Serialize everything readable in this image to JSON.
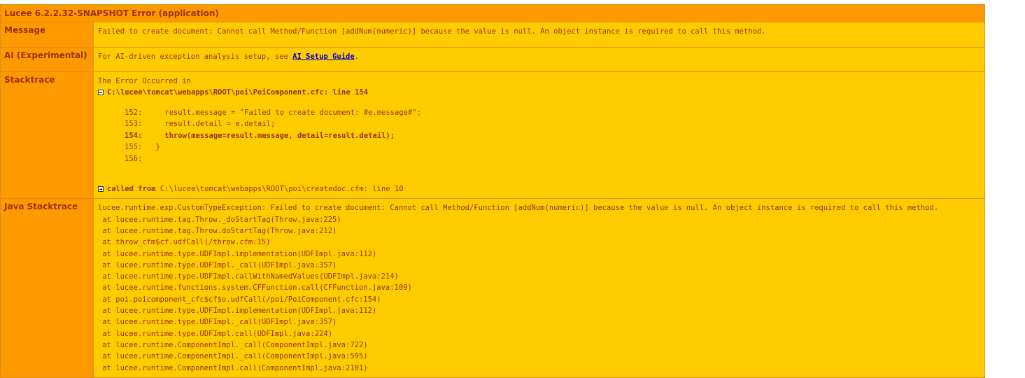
{
  "title": "Lucee 6.2.2.32-SNAPSHOT Error (application)",
  "message": {
    "label": "Message",
    "text": "Failed to create document: Cannot call Method/Function [addNum(numeric)] because the value is null. An object instance is required to call this method."
  },
  "ai": {
    "label": "AI (Experimental)",
    "prefix": "For AI-driven exception analysis setup, see ",
    "link": "AI Setup Guide",
    "suffix": "."
  },
  "stacktrace": {
    "label": "Stacktrace",
    "intro": "The Error Occurred in",
    "file": "C:\\lucee\\tomcat\\webapps\\ROOT\\poi\\PoiComponent.cfc: line 154",
    "code": [
      {
        "ln": "152:",
        "text": "    result.message = \"Failed to create document: #e.message#\";",
        "highlight": false
      },
      {
        "ln": "153:",
        "text": "    result.detail = e.detail;",
        "highlight": false
      },
      {
        "ln": "154:",
        "text": "    throw(message=result.message, detail=result.detail);",
        "highlight": true
      },
      {
        "ln": "155:",
        "text": "  }",
        "highlight": false
      },
      {
        "ln": "156:",
        "text": "",
        "highlight": false
      }
    ],
    "called_from_label": "called from",
    "called_from": " C:\\lucee\\tomcat\\webapps\\ROOT\\poi\\createdoc.cfm: line 10"
  },
  "java_stacktrace": {
    "label": "Java Stacktrace",
    "lines": [
      "lucee.runtime.exp.CustomTypeException: Failed to create document: Cannot call Method/Function [addNum(numeric)] because the value is null. An object instance is required to call this method.",
      " at lucee.runtime.tag.Throw._doStartTag(Throw.java:225)",
      " at lucee.runtime.tag.Throw.doStartTag(Throw.java:212)",
      " at throw_cfm$cf.udfCall(/throw.cfm:15)",
      " at lucee.runtime.type.UDFImpl.implementation(UDFImpl.java:112)",
      " at lucee.runtime.type.UDFImpl._call(UDFImpl.java:357)",
      " at lucee.runtime.type.UDFImpl.callWithNamedValues(UDFImpl.java:214)",
      " at lucee.runtime.functions.system.CFFunction.call(CFFunction.java:109)",
      " at poi.poicomponent_cfc$cf$o.udfCall(/poi/PoiComponent.cfc:154)",
      " at lucee.runtime.type.UDFImpl.implementation(UDFImpl.java:112)",
      " at lucee.runtime.type.UDFImpl._call(UDFImpl.java:357)",
      " at lucee.runtime.type.UDFImpl.call(UDFImpl.java:224)",
      " at lucee.runtime.ComponentImpl._call(ComponentImpl.java:722)",
      " at lucee.runtime.ComponentImpl._call(ComponentImpl.java:595)",
      " at lucee.runtime.ComponentImpl.call(ComponentImpl.java:2101)"
    ]
  },
  "colors": {
    "header_bg": "#ff9900",
    "value_bg": "#ffcc00",
    "text": "#993300",
    "link": "#0000cc"
  },
  "icons": {
    "collapse": "minus-box-icon",
    "expand": "plus-box-icon"
  }
}
